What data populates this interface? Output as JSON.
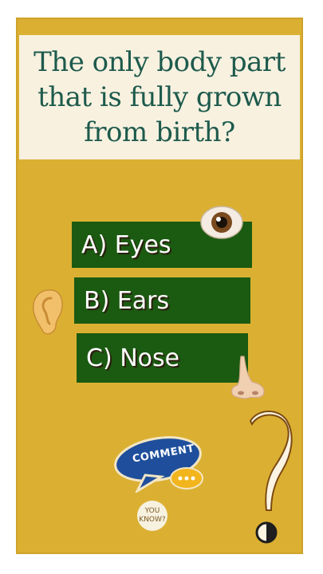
{
  "question": "The only body part that is fully grown from birth?",
  "answers": [
    {
      "label": "A) Eyes"
    },
    {
      "label": "B) Ears"
    },
    {
      "label": "C) Nose"
    }
  ],
  "comment_bubble": {
    "label": "COMMENT"
  },
  "logo": {
    "line1": "YOU",
    "line2": "KNOW?"
  },
  "icons": [
    "eye-icon",
    "ear-icon",
    "nose-icon",
    "question-mark-icon",
    "speech-bubble-icon"
  ],
  "colors": {
    "background": "#dbb032",
    "question_box": "#f8f1e0",
    "question_text": "#1d5a4c",
    "answer_button": "#1b5a11",
    "comment_bubble": "#1f4f9c"
  }
}
